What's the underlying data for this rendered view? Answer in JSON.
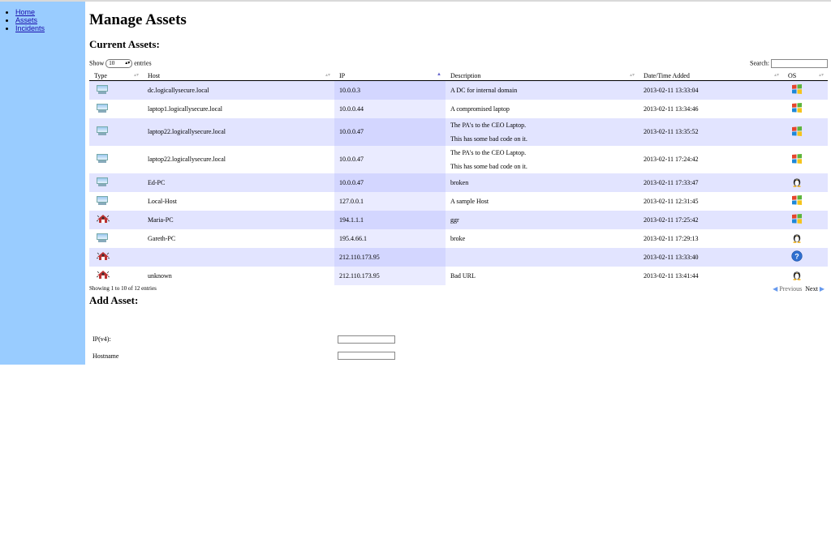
{
  "nav": [
    {
      "label": "Home"
    },
    {
      "label": "Assets"
    },
    {
      "label": "Incidents"
    }
  ],
  "page": {
    "title": "Manage Assets",
    "current_heading": "Current Assets:",
    "add_heading": "Add Asset:"
  },
  "table_controls": {
    "show_label": "Show",
    "entries_value": "10",
    "entries_label": "entries",
    "search_label": "Search:"
  },
  "columns": [
    "Type",
    "Host",
    "IP",
    "Description",
    "Date/Time Added",
    "OS"
  ],
  "sorted_column": "IP",
  "rows": [
    {
      "type": "workstation",
      "host": "dc.logicallysecure.local",
      "ip": "10.0.0.3",
      "desc": [
        "A DC for internal domain"
      ],
      "date": "2013-02-11 13:33:04",
      "os": "windows"
    },
    {
      "type": "workstation",
      "host": "laptop1.logicallysecure.local",
      "ip": "10.0.0.44",
      "desc": [
        "A compromised laptop"
      ],
      "date": "2013-02-11 13:34:46",
      "os": "windows"
    },
    {
      "type": "workstation",
      "host": "laptop22.logicallysecure.local",
      "ip": "10.0.0.47",
      "desc": [
        "The PA's to the CEO Laptop.",
        "This has some bad code on it."
      ],
      "date": "2013-02-11 13:35:52",
      "os": "windows"
    },
    {
      "type": "workstation",
      "host": "laptop22.logicallysecure.local",
      "ip": "10.0.0.47",
      "desc": [
        "The PA's to the CEO Laptop.",
        "This has some bad code on it."
      ],
      "date": "2013-02-11 17:24:42",
      "os": "windows"
    },
    {
      "type": "workstation",
      "host": "Ed-PC",
      "ip": "10.0.0.47",
      "desc": [
        "broken"
      ],
      "date": "2013-02-11 17:33:47",
      "os": "linux"
    },
    {
      "type": "workstation",
      "host": "Local-Host",
      "ip": "127.0.0.1",
      "desc": [
        "A sample Host"
      ],
      "date": "2013-02-11 12:31:45",
      "os": "windows"
    },
    {
      "type": "malicious",
      "host": "Maria-PC",
      "ip": "194.1.1.1",
      "desc": [
        "ggr"
      ],
      "date": "2013-02-11 17:25:42",
      "os": "windows"
    },
    {
      "type": "workstation",
      "host": "Gareth-PC",
      "ip": "195.4.66.1",
      "desc": [
        "broke"
      ],
      "date": "2013-02-11 17:29:13",
      "os": "linux"
    },
    {
      "type": "malicious",
      "host": "",
      "ip": "212.110.173.95",
      "desc": [
        ""
      ],
      "date": "2013-02-11 13:33:40",
      "os": "unknown"
    },
    {
      "type": "malicious",
      "host": "unknown",
      "ip": "212.110.173.95",
      "desc": [
        "Bad URL"
      ],
      "date": "2013-02-11 13:41:44",
      "os": "linux"
    }
  ],
  "footer": {
    "info": "Showing 1 to 10 of 12 entries",
    "previous": "Previous",
    "next": "Next"
  },
  "form": {
    "ip_label": "IP(v4):",
    "ip_value": "",
    "hostname_label": "Hostname",
    "hostname_value": ""
  },
  "colors": {
    "sidebar": "#99ccff",
    "odd_row": "#e2e4ff",
    "sorted_col": "#d3d6ff"
  }
}
